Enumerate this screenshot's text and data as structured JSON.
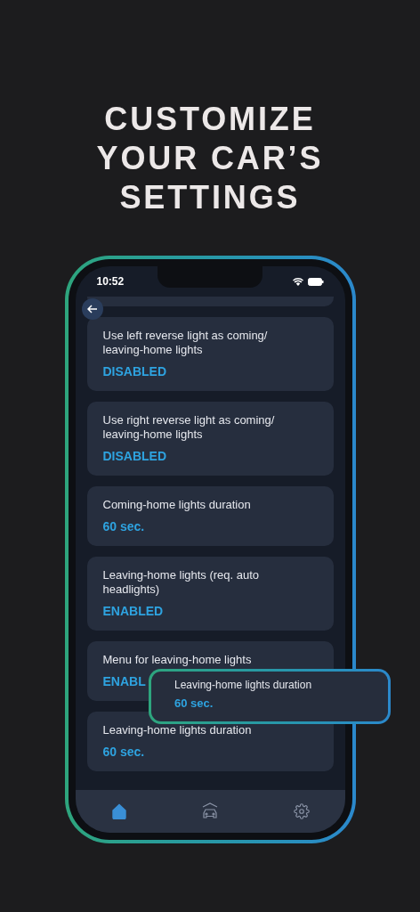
{
  "headline": [
    "CUSTOMIZE",
    "YOUR CAR’S",
    "SETTINGS"
  ],
  "status_bar": {
    "time": "10:52"
  },
  "settings": [
    {
      "label": "Use left reverse light as coming/ leaving-home lights",
      "value": "DISABLED"
    },
    {
      "label": "Use right reverse light as coming/ leaving-home lights",
      "value": "DISABLED"
    },
    {
      "label": "Coming-home lights duration",
      "value": "60 sec."
    },
    {
      "label": "Leaving-home lights (req. auto headlights)",
      "value": "ENABLED"
    },
    {
      "label": "Menu for leaving-home lights",
      "value": "ENABL"
    },
    {
      "label": "Leaving-home lights duration",
      "value": "60 sec."
    }
  ],
  "callout": {
    "label": "Leaving-home lights duration",
    "value": "60 sec."
  },
  "nav": [
    {
      "kind": "home",
      "selected": true
    },
    {
      "kind": "car",
      "selected": false
    },
    {
      "kind": "settings",
      "selected": false
    }
  ]
}
